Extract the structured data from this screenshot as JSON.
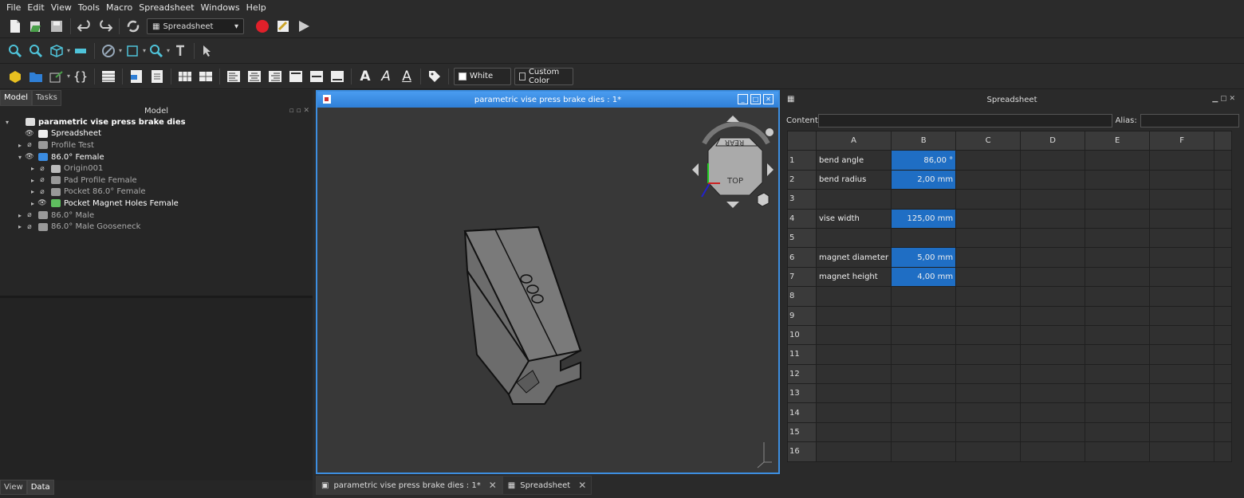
{
  "menu": [
    "File",
    "Edit",
    "View",
    "Tools",
    "Macro",
    "Spreadsheet",
    "Windows",
    "Help"
  ],
  "toolbar": {
    "workbench": "Spreadsheet",
    "white_label": "White",
    "custom_color_label": "Custom Color"
  },
  "left_panel": {
    "tabs": [
      "Model",
      "Tasks"
    ],
    "title": "Model",
    "bottom_tabs": [
      "View",
      "Data"
    ],
    "tree": [
      {
        "label": "parametric vise press brake dies",
        "indent": 0
      },
      {
        "label": "Spreadsheet",
        "indent": 1
      },
      {
        "label": "Profile Test",
        "indent": 1
      },
      {
        "label": "86.0° Female",
        "indent": 1
      },
      {
        "label": "Origin001",
        "indent": 2
      },
      {
        "label": "Pad Profile Female",
        "indent": 2
      },
      {
        "label": "Pocket 86.0° Female",
        "indent": 2
      },
      {
        "label": "Pocket Magnet Holes Female",
        "indent": 2
      },
      {
        "label": "86.0° Male",
        "indent": 1
      },
      {
        "label": "86.0° Male Gooseneck",
        "indent": 1
      }
    ]
  },
  "view_window": {
    "title": "parametric vise press brake dies : 1*",
    "navcube_top": "TOP",
    "navcube_rear": "REAR"
  },
  "bottom_tabs": [
    "parametric vise press brake dies : 1*",
    "Spreadsheet"
  ],
  "spreadsheet": {
    "title": "Spreadsheet",
    "content_label": "Content:",
    "alias_label": "Alias:",
    "columns": [
      "A",
      "B",
      "C",
      "D",
      "E",
      "F"
    ],
    "rows": [
      {
        "n": "1",
        "a": "bend angle",
        "b": "86,00 °"
      },
      {
        "n": "2",
        "a": "bend radius",
        "b": "2,00 mm"
      },
      {
        "n": "3",
        "a": "",
        "b": ""
      },
      {
        "n": "4",
        "a": "vise width",
        "b": "125,00 mm"
      },
      {
        "n": "5",
        "a": "",
        "b": ""
      },
      {
        "n": "6",
        "a": "magnet diameter",
        "b": "5,00 mm"
      },
      {
        "n": "7",
        "a": "magnet height",
        "b": "4,00 mm"
      },
      {
        "n": "8",
        "a": "",
        "b": ""
      },
      {
        "n": "9",
        "a": "",
        "b": ""
      },
      {
        "n": "10",
        "a": "",
        "b": ""
      },
      {
        "n": "11",
        "a": "",
        "b": ""
      },
      {
        "n": "12",
        "a": "",
        "b": ""
      },
      {
        "n": "13",
        "a": "",
        "b": ""
      },
      {
        "n": "14",
        "a": "",
        "b": ""
      },
      {
        "n": "15",
        "a": "",
        "b": ""
      },
      {
        "n": "16",
        "a": "",
        "b": ""
      }
    ]
  },
  "colors": {
    "accent": "#2f7fd6",
    "selected_cell": "#1f6ec4",
    "record": "#e0202a"
  }
}
